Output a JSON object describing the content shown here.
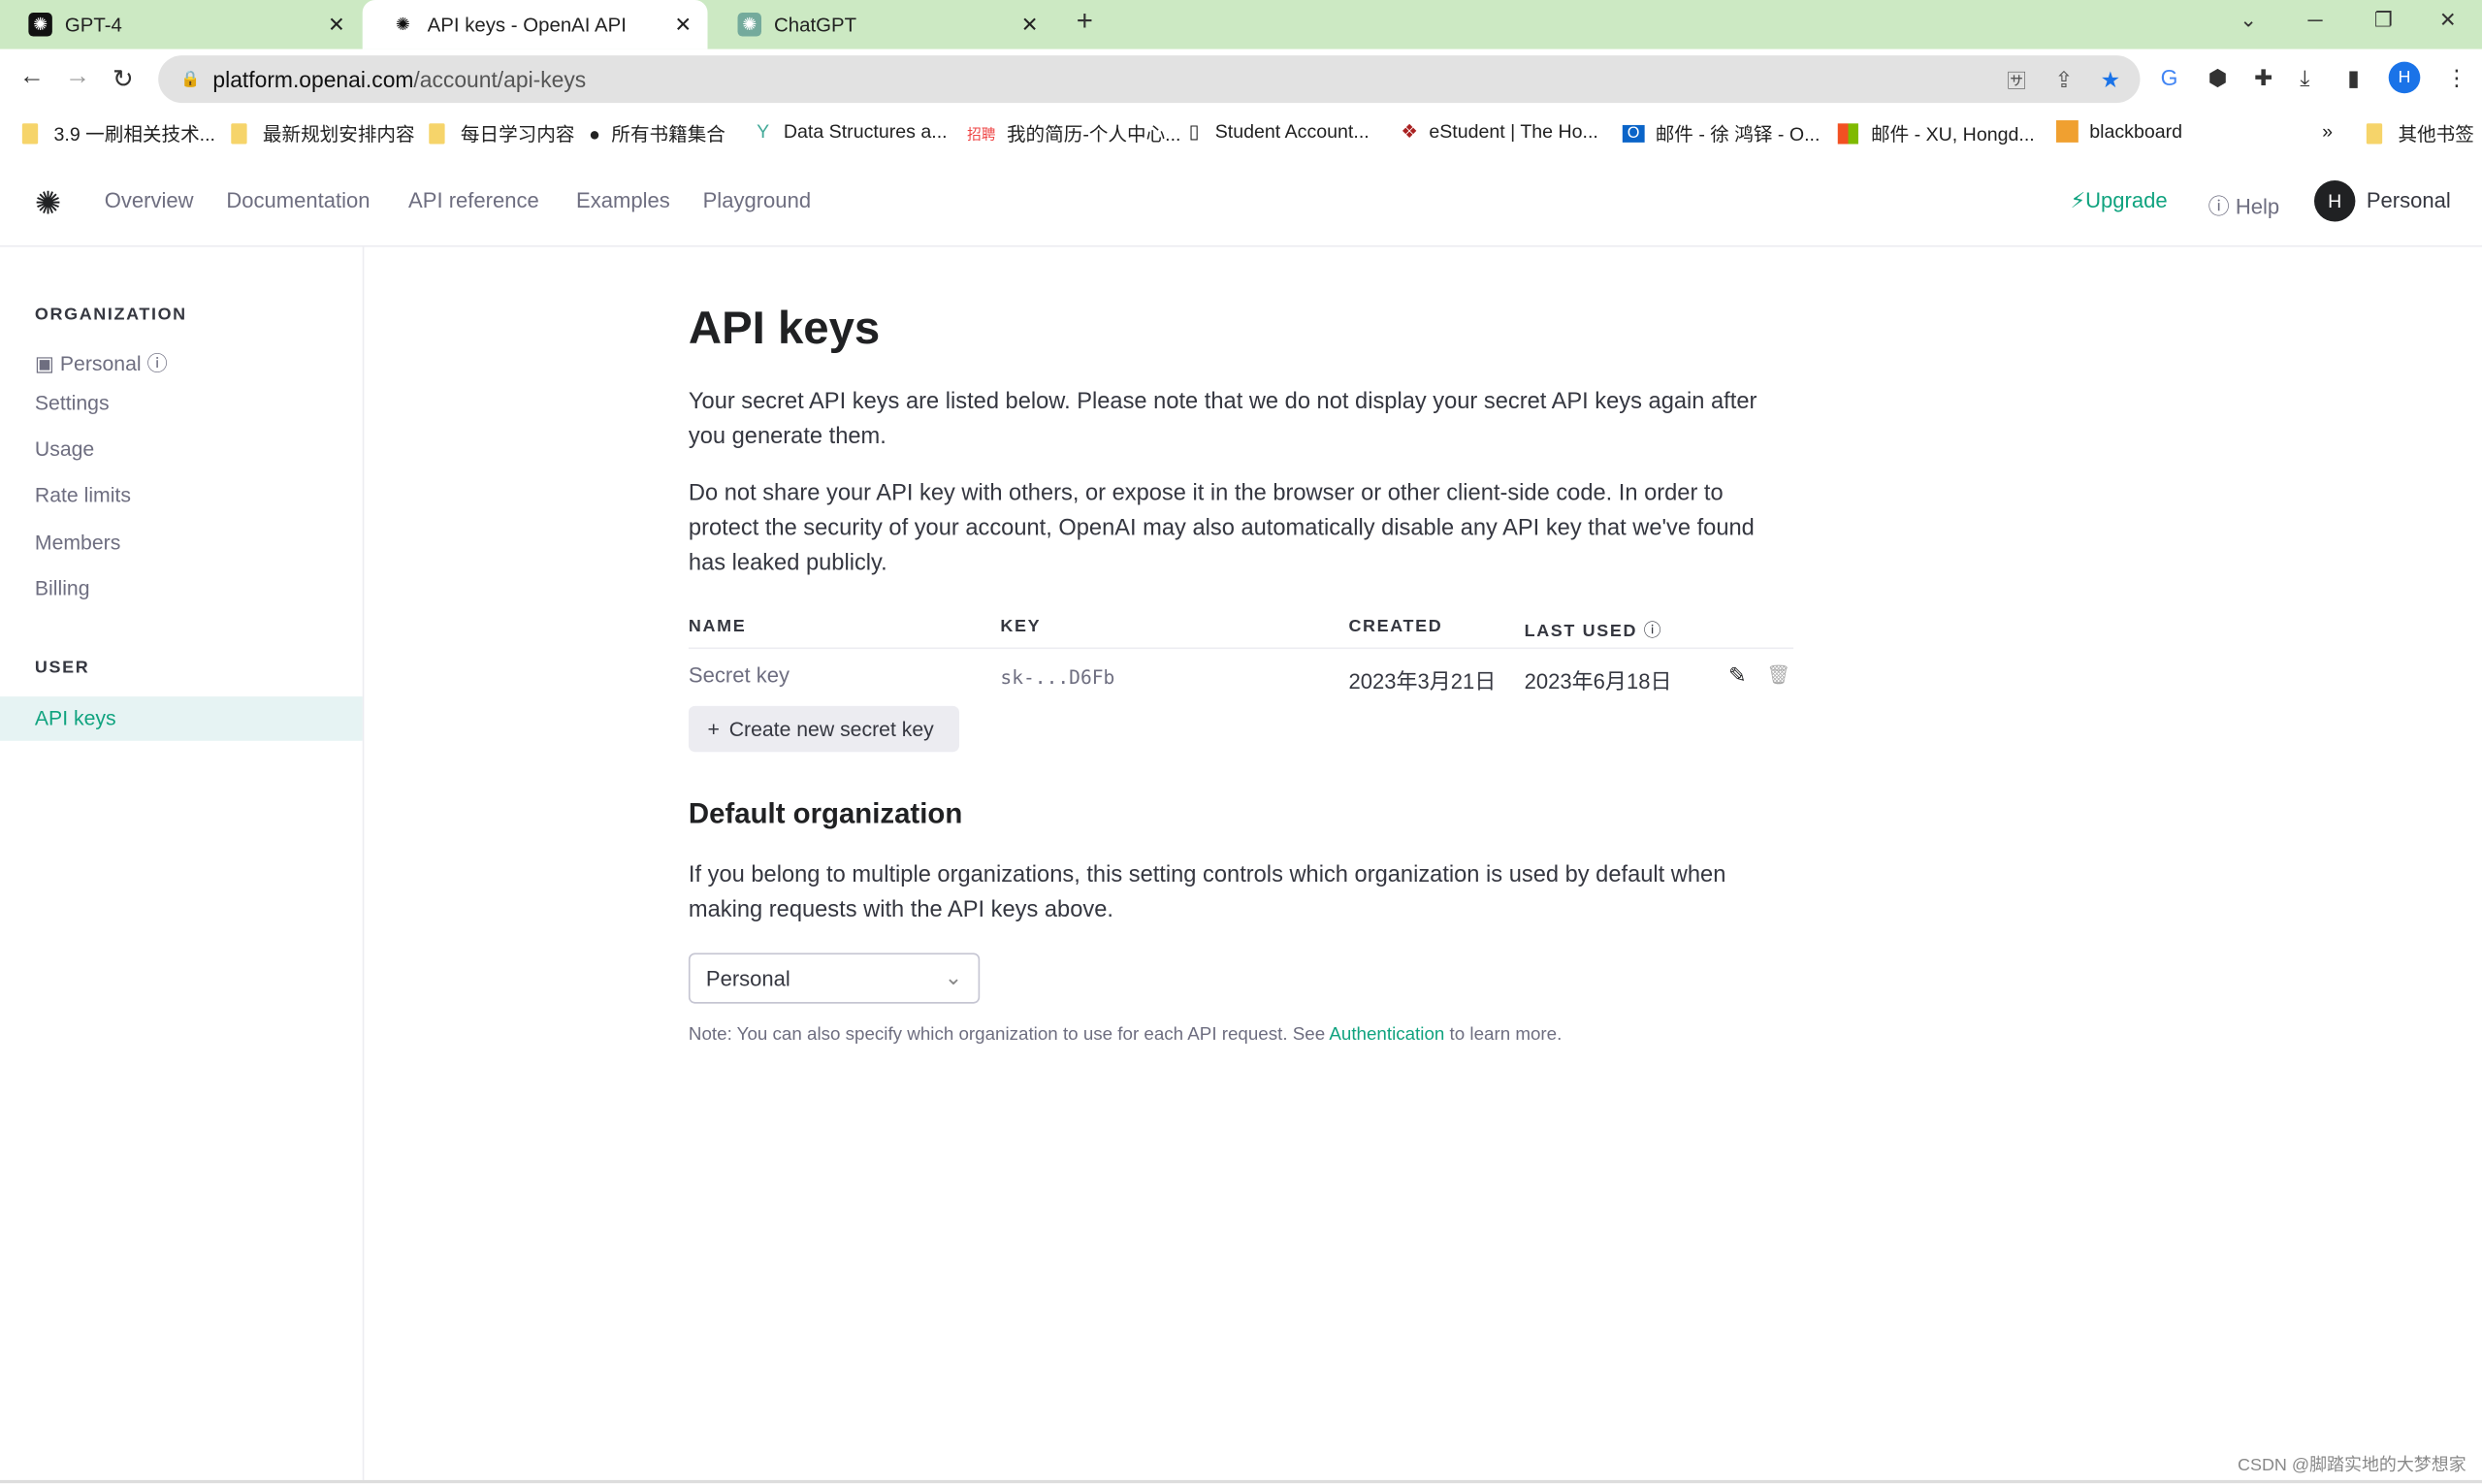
{
  "browser": {
    "tabs": [
      {
        "title": "GPT-4",
        "active": false
      },
      {
        "title": "API keys - OpenAI API",
        "active": true
      },
      {
        "title": "ChatGPT",
        "active": false
      }
    ],
    "url_host": "platform.openai.com",
    "url_path": "/account/api-keys",
    "bookmarks": [
      "3.9 一刷相关技术...",
      "最新规划安排内容",
      "每日学习内容",
      "所有书籍集合",
      "Data Structures a...",
      "我的简历-个人中心...",
      "Student Account...",
      "eStudent | The Ho...",
      "邮件 - 徐 鸿铎 - O...",
      "邮件 - XU, Hongd...",
      "blackboard"
    ],
    "bookmarks_overflow": "»",
    "other_bookmarks": "其他书签",
    "profile_initial": "H"
  },
  "header": {
    "nav": [
      "Overview",
      "Documentation",
      "API reference",
      "Examples",
      "Playground"
    ],
    "upgrade": "Upgrade",
    "help": "Help",
    "account_initial": "H",
    "account": "Personal",
    "accent": "#10a37f"
  },
  "sidebar": {
    "org_heading": "ORGANIZATION",
    "org_name": "Personal",
    "org_items": [
      "Settings",
      "Usage",
      "Rate limits",
      "Members",
      "Billing"
    ],
    "user_heading": "USER",
    "user_items": [
      "API keys"
    ]
  },
  "main": {
    "title": "API keys",
    "intro": "Your secret API keys are listed below. Please note that we do not display your secret API keys again after you generate them.",
    "warning": "Do not share your API key with others, or expose it in the browser or other client-side code. In order to protect the security of your account, OpenAI may also automatically disable any API key that we've found has leaked publicly.",
    "table": {
      "headers": [
        "NAME",
        "KEY",
        "CREATED",
        "LAST USED"
      ],
      "rows": [
        {
          "name": "Secret key",
          "key": "sk-...D6Fb",
          "created": "2023年3月21日",
          "last_used": "2023年6月18日"
        }
      ]
    },
    "create_button": "Create new secret key",
    "default_org_title": "Default organization",
    "default_org_text": "If you belong to multiple organizations, this setting controls which organization is used by default when making requests with the API keys above.",
    "org_select": "Personal",
    "note_prefix": "Note: You can also specify which organization to use for each API request. See ",
    "note_link": "Authentication",
    "note_suffix": " to learn more."
  },
  "watermark": "CSDN @脚踏实地的大梦想家"
}
